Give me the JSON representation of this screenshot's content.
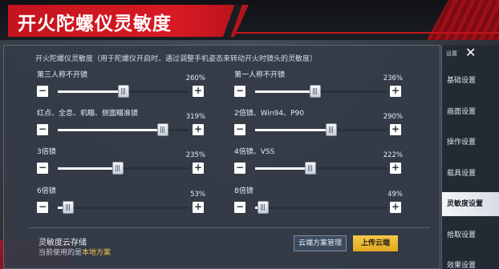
{
  "header": {
    "title": "开火陀螺仪灵敏度",
    "intro": "开火陀螺仪灵敏度（用于陀螺仪开启时，通过调整手机姿态来转动开火时镜头的灵敏度）"
  },
  "sliders": [
    {
      "label": "第三人称不开镜",
      "value_text": "260%",
      "fraction": 0.5
    },
    {
      "label": "第一人称不开镜",
      "value_text": "236%",
      "fraction": 0.46
    },
    {
      "label": "红点、全息、机瞄、侧面瞄准镜",
      "value_text": "319%",
      "fraction": 0.8
    },
    {
      "label": "2倍镜、Win94、P90",
      "value_text": "290%",
      "fraction": 0.58
    },
    {
      "label": "3倍镜",
      "value_text": "235%",
      "fraction": 0.46
    },
    {
      "label": "4倍镜、VSS",
      "value_text": "222%",
      "fraction": 0.42
    },
    {
      "label": "6倍镜",
      "value_text": "53%",
      "fraction": 0.08
    },
    {
      "label": "8倍镜",
      "value_text": "49%",
      "fraction": 0.06
    }
  ],
  "stepper": {
    "minus": "−",
    "plus": "+"
  },
  "cloud": {
    "title": "灵敏度云存储",
    "current_prefix": "当前使用的是",
    "current_scheme": "本地方案",
    "manage_button": "云端方案管理",
    "upload_button": "上传云端"
  },
  "nav": {
    "close_label": "设置",
    "close_icon": "close-icon",
    "items": [
      {
        "label": "基础设置",
        "active": false
      },
      {
        "label": "画面设置",
        "active": false
      },
      {
        "label": "操作设置",
        "active": false
      },
      {
        "label": "载具设置",
        "active": false
      },
      {
        "label": "灵敏度设置",
        "active": true
      },
      {
        "label": "拾取设置",
        "active": false
      },
      {
        "label": "效果设置",
        "active": false
      }
    ]
  },
  "colors": {
    "accent_red": "#c4141e",
    "accent_yellow": "#e2a81f"
  }
}
